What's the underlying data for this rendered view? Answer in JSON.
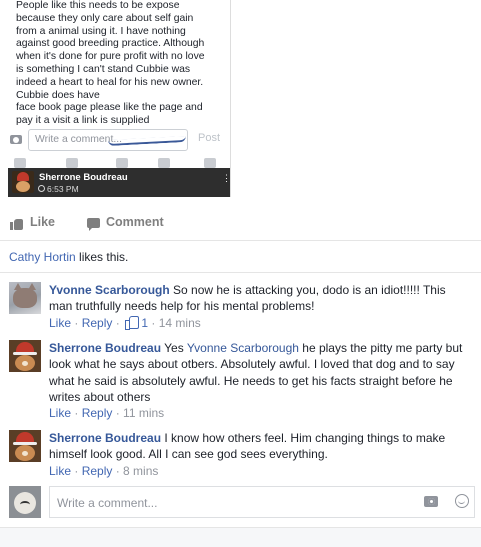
{
  "embed": {
    "post_text": "People like this needs to be expose\nbecause they only care about self gain\nfrom a animal using it. I have nothing\nagainst good breeding practice. Although\nwhen it's done for pure profit with no love\nis something I can't stand Cubbie was\nindeed a heart to heal for his new owner.\nCubbie does have\nface book page please like the page and\npay it a visit a link is supplied",
    "comment_placeholder": "Write a comment...",
    "post_label": "Post",
    "author_name": "Sherrone Boudreau",
    "time": "6:53 PM",
    "menu_dots": "⋮"
  },
  "actions": {
    "like_label": "Like",
    "comment_label": "Comment"
  },
  "likes": {
    "name": "Cathy Hortin",
    "suffix": " likes this."
  },
  "comments": [
    {
      "name": "Yvonne Scarborough",
      "text": " So now he is attacking you, dodo is an idiot!!!!! This man truthfully needs help for his mental problems!",
      "like": "Like",
      "reply": "Reply",
      "like_count": "1",
      "time": "14 mins"
    },
    {
      "name": "Sherrone Boudreau",
      "pre": " Yes ",
      "mention": "Yvonne Scarborough",
      "text": " he plays the pitty me party but look what he says about otbers. Absolutely awful. I loved that dog and to say what he said is absolutely awful. He needs to get his facts straight before he writes about others",
      "like": "Like",
      "reply": "Reply",
      "time": "11 mins"
    },
    {
      "name": "Sherrone Boudreau",
      "text": " I know how others feel. Him changing things to make himself look good. All I can see god sees everything.",
      "like": "Like",
      "reply": "Reply",
      "time": "8 mins"
    }
  ],
  "write": {
    "placeholder": "Write a comment..."
  },
  "meta_separator": " · ",
  "colors": {
    "link": "#365899",
    "meta": "#90949c",
    "like_blue": "#4267b2"
  }
}
